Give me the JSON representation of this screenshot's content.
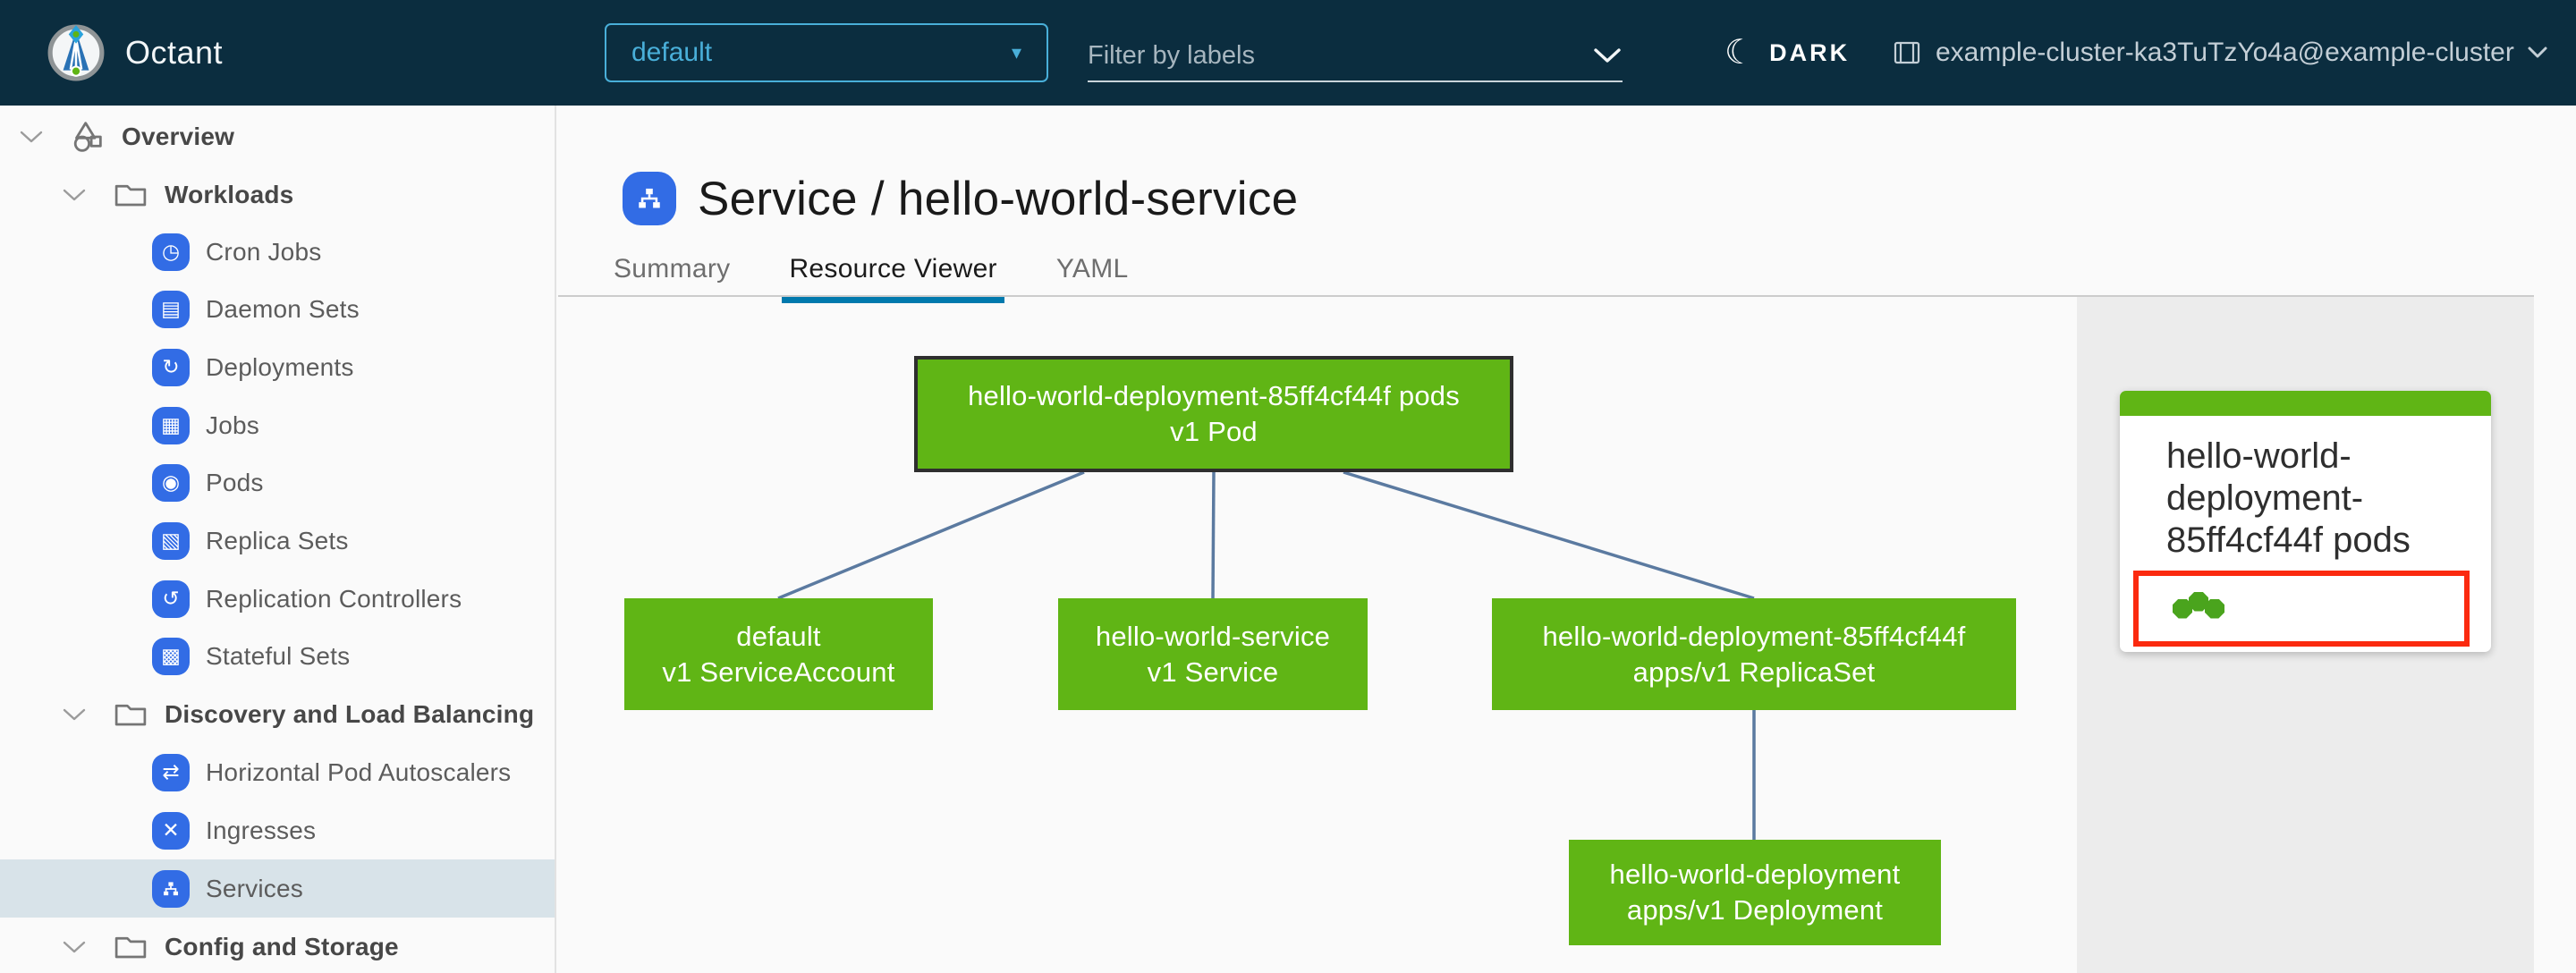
{
  "colors": {
    "header_bg": "#0b2d3f",
    "accent_blue": "#49afd9",
    "k8s_icon_blue": "#326ce5",
    "node_green": "#60b515",
    "edge_blue": "#5b7aa0",
    "tab_active_underline": "#0079ad",
    "sidebar_selected_bg": "#d8e3e9",
    "panel_bg": "#ececec",
    "annotation_red": "#fb2a0f",
    "status_dot_green": "#4aa41d"
  },
  "icons": {
    "moon": "☾",
    "select_caret": "▾",
    "cron_jobs": "◷",
    "daemon_sets": "▤",
    "deployments": "↻",
    "jobs": "▦",
    "pods": "◉",
    "replica_sets": "▧",
    "replication_controllers": "↺",
    "stateful_sets": "▩",
    "horizontal_pod_autoscalers": "⇄",
    "ingresses": "✕"
  },
  "header": {
    "app_name": "Octant",
    "namespace_selector": {
      "value": "default"
    },
    "filter": {
      "placeholder": "Filter by labels"
    },
    "theme_toggle": {
      "label": "DARK"
    },
    "context_selector": {
      "label": "example-cluster-ka3TuTzYo4a@example-cluster"
    }
  },
  "sidebar": {
    "items": [
      {
        "label": "Overview"
      },
      {
        "label": "Workloads"
      },
      {
        "label": "Cron Jobs"
      },
      {
        "label": "Daemon Sets"
      },
      {
        "label": "Deployments"
      },
      {
        "label": "Jobs"
      },
      {
        "label": "Pods"
      },
      {
        "label": "Replica Sets"
      },
      {
        "label": "Replication Controllers"
      },
      {
        "label": "Stateful Sets"
      },
      {
        "label": "Discovery and Load Balancing"
      },
      {
        "label": "Horizontal Pod Autoscalers"
      },
      {
        "label": "Ingresses"
      },
      {
        "label": "Services",
        "selected": true
      },
      {
        "label": "Config and Storage"
      }
    ]
  },
  "main": {
    "page_title": "Service / hello-world-service",
    "tabs": [
      {
        "label": "Summary",
        "active": false
      },
      {
        "label": "Resource Viewer",
        "active": true
      },
      {
        "label": "YAML",
        "active": false
      }
    ],
    "graph": {
      "nodes": {
        "pod": {
          "name": "hello-world-deployment-85ff4cf44f pods",
          "kind": "v1 Pod",
          "selected": true
        },
        "service_account": {
          "name": "default",
          "kind": "v1 ServiceAccount"
        },
        "service": {
          "name": "hello-world-service",
          "kind": "v1 Service"
        },
        "replica_set": {
          "name": "hello-world-deployment-85ff4cf44f",
          "kind": "apps/v1 ReplicaSet"
        },
        "deployment": {
          "name": "hello-world-deployment",
          "kind": "apps/v1 Deployment"
        }
      },
      "edges": [
        "pod - service_account",
        "pod - service",
        "pod - replica_set",
        "replica_set - deployment"
      ]
    },
    "side_card": {
      "title": "hello-world-deployment-85ff4cf44f pods",
      "pod_status_dots": 3,
      "pod_status": "ok"
    }
  }
}
